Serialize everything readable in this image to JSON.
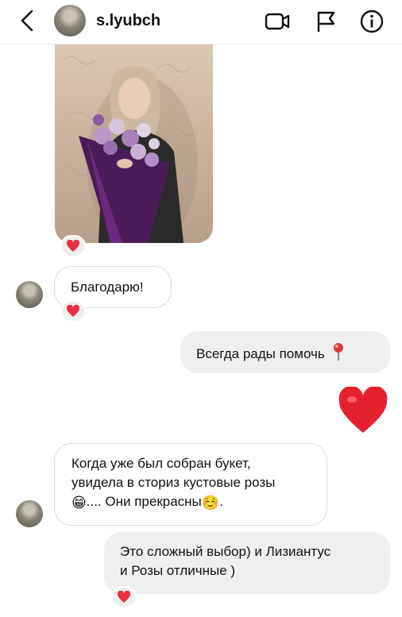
{
  "header": {
    "username": "s.lyubch",
    "icons": [
      "back-chevron-icon",
      "video-call-icon",
      "flag-icon",
      "info-icon"
    ]
  },
  "messages": [
    {
      "id": "photo",
      "type": "image",
      "direction": "incoming",
      "reaction": "❤️"
    },
    {
      "id": "m1",
      "direction": "incoming",
      "text": "Благодарю!",
      "reaction": "❤️"
    },
    {
      "id": "m2",
      "direction": "outgoing",
      "text": "Всегда рады помочь",
      "emoji": "📍"
    },
    {
      "id": "m3",
      "direction": "outgoing",
      "type": "big-emoji",
      "emoji": "❤️"
    },
    {
      "id": "m4",
      "direction": "incoming",
      "lines": [
        "Когда уже был собран букет,",
        "увидела в сториз кустовые розы",
        ".... Они прекрасны",
        "."
      ],
      "emojis": [
        "😁",
        "☺️"
      ]
    },
    {
      "id": "m5",
      "direction": "outgoing",
      "lines": [
        "Это сложный выбор) и Лизиантус",
        "и Розы отличные )"
      ],
      "reaction": "❤️"
    }
  ],
  "colors": {
    "reaction_heart": "#e8313f",
    "bubble_out": "#efefef",
    "bubble_in_border": "#dbdbdb"
  }
}
